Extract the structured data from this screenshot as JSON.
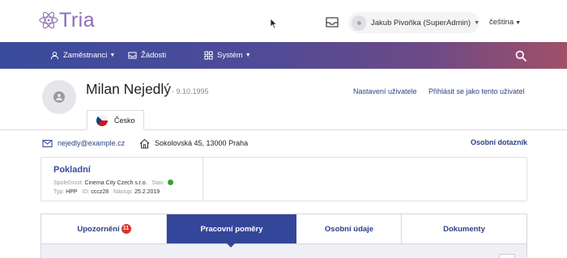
{
  "header": {
    "logo_text": "Tria",
    "user_name": "Jakub Pivoňka (SuperAdmin)",
    "language": "čeština"
  },
  "nav": {
    "items": [
      {
        "label": "Zaměstnanci",
        "icon": "users-icon",
        "has_dropdown": true
      },
      {
        "label": "Žádosti",
        "icon": "inbox-icon",
        "has_dropdown": false
      },
      {
        "label": "Systém",
        "icon": "grid-icon",
        "has_dropdown": true
      }
    ],
    "search_icon": "search-icon"
  },
  "profile": {
    "name": "Milan Nejedlý",
    "birth_date": "- 9.10.1995",
    "link_settings": "Nastavení uživatele",
    "link_login_as": "Přihlásit se jako tento uživatel",
    "country_tab": "Česko"
  },
  "contact": {
    "email": "nejedly@example.cz",
    "address": "Sokolovská 45, 13000 Praha",
    "questionnaire": "Osobní dotazník"
  },
  "job": {
    "title": "Pokladní",
    "company_label": "Společnost:",
    "company": "Cinema City Czech s.r.o.",
    "status_label": "Stav:",
    "type_label": "Typ:",
    "type": "HPP",
    "id_label": "ID:",
    "id": "cccz28",
    "start_label": "Nástup:",
    "start": "25.2.2019"
  },
  "tabs": {
    "items": [
      {
        "label": "Upozornění",
        "badge": "11",
        "active": false
      },
      {
        "label": "Pracovní poměry",
        "active": true
      },
      {
        "label": "Osobní údaje",
        "active": false
      },
      {
        "label": "Dokumenty",
        "active": false
      }
    ]
  },
  "colors": {
    "primary": "#34469a",
    "accent_purple": "#8e6cb7",
    "link": "#2e3f86",
    "status_ok": "#38a02f",
    "badge": "#d8342b"
  }
}
